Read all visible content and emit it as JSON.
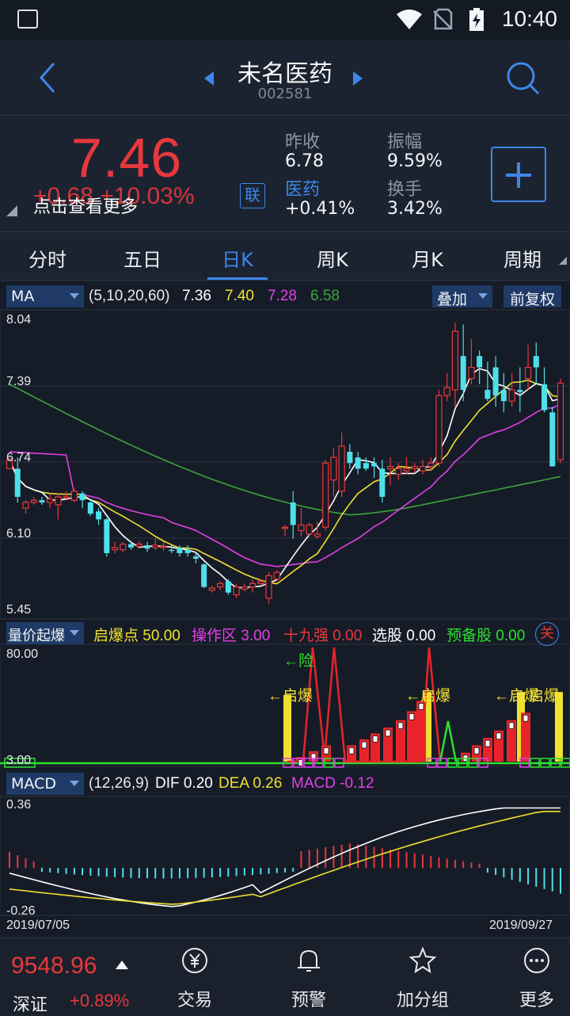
{
  "status": {
    "time": "10:40"
  },
  "header": {
    "name": "未名医药",
    "code": "002581"
  },
  "quote": {
    "price": "7.46",
    "change": "+0.68 +10.03%",
    "tip": "点击查看更多",
    "lian": "联",
    "fields": [
      {
        "key": "昨收",
        "value": "6.78"
      },
      {
        "key": "振幅",
        "value": "9.59%"
      },
      {
        "key": "医药",
        "value": "+0.41%"
      },
      {
        "key": "换手",
        "value": "3.42%"
      }
    ]
  },
  "tabs": [
    "分时",
    "五日",
    "日K",
    "周K",
    "月K",
    "周期"
  ],
  "active_tab": "日K",
  "ma": {
    "label": "MA",
    "params": "(5,10,20,60)",
    "v5": "7.36",
    "v10": "7.40",
    "v20": "7.28",
    "v60": "6.58",
    "overlay": "叠加",
    "adjust": "前复权",
    "yaxis": [
      "8.04",
      "7.39",
      "6.74",
      "6.10",
      "5.45"
    ]
  },
  "vol_indicator": {
    "label": "量价起爆",
    "k1": "启爆点",
    "v1": "50.00",
    "k2": "操作区",
    "v2": "3.00",
    "k3": "十九强",
    "v3": "0.00",
    "k4": "选股",
    "v4": "0.00",
    "k5": "预备股",
    "v5": "0.00",
    "close": "关",
    "ytop": "80.00",
    "ybot": "3.00",
    "annotations": [
      "←险",
      "←启爆",
      "←启爆",
      "←启爆",
      "启爆"
    ]
  },
  "macd": {
    "label": "MACD",
    "params": "(12,26,9)",
    "dif_k": "DIF",
    "dif": "0.20",
    "dea_k": "DEA",
    "dea": "0.26",
    "macd_k": "MACD",
    "macd": "-0.12",
    "ytop": "0.36",
    "ybot": "-0.26",
    "date_start": "2019/07/05",
    "date_end": "2019/09/27"
  },
  "footer": {
    "index_value": "9548.96",
    "index_name": "深证",
    "index_change": "+0.89%",
    "nav": [
      "交易",
      "预警",
      "加分组",
      "更多"
    ]
  },
  "colors": {
    "up": "#e8383d",
    "down": "#4ee0ea",
    "accent": "#3d87ea",
    "ma5": "#ffffff",
    "ma10": "#f0e030",
    "ma20": "#e040e8",
    "ma60": "#3aa63a"
  },
  "chart_data": {
    "type": "candlestick",
    "ylim": [
      5.45,
      8.04
    ],
    "candles": [
      [
        6.7,
        6.78,
        6.75,
        6.8
      ],
      [
        6.7,
        6.45,
        6.8,
        6.4
      ],
      [
        6.35,
        6.4,
        6.42,
        6.3
      ],
      [
        6.4,
        6.42,
        6.45,
        6.38
      ],
      [
        6.42,
        6.4,
        6.45,
        6.38
      ],
      [
        6.4,
        6.43,
        6.48,
        6.35
      ],
      [
        6.38,
        6.45,
        6.48,
        6.25
      ],
      [
        6.45,
        6.45,
        6.5,
        6.42
      ],
      [
        6.42,
        6.5,
        6.52,
        6.4
      ],
      [
        6.48,
        6.42,
        6.5,
        6.35
      ],
      [
        6.4,
        6.3,
        6.42,
        6.28
      ],
      [
        6.32,
        6.25,
        6.35,
        6.2
      ],
      [
        6.25,
        5.95,
        6.26,
        5.92
      ],
      [
        5.98,
        6.0,
        6.05,
        5.95
      ],
      [
        5.98,
        6.03,
        6.05,
        5.96
      ],
      [
        6.03,
        6.0,
        6.06,
        5.98
      ],
      [
        6.01,
        6.03,
        6.06,
        5.99
      ],
      [
        6.02,
        5.99,
        6.05,
        5.96
      ],
      [
        6.0,
        6.02,
        6.08,
        5.98
      ],
      [
        6.0,
        6.01,
        6.05,
        5.97
      ],
      [
        5.98,
        5.97,
        6.02,
        5.95
      ],
      [
        6.0,
        5.95,
        6.02,
        5.92
      ],
      [
        5.98,
        5.95,
        6.02,
        5.92
      ],
      [
        5.92,
        5.9,
        5.96,
        5.86
      ],
      [
        5.85,
        5.65,
        5.86,
        5.64
      ],
      [
        5.62,
        5.64,
        5.66,
        5.6
      ],
      [
        5.65,
        5.68,
        5.7,
        5.62
      ],
      [
        5.7,
        5.6,
        5.72,
        5.58
      ],
      [
        5.58,
        5.65,
        5.68,
        5.55
      ],
      [
        5.63,
        5.65,
        5.68,
        5.61
      ],
      [
        5.65,
        5.68,
        5.72,
        5.6
      ],
      [
        5.68,
        5.7,
        5.72,
        5.66
      ],
      [
        5.55,
        5.75,
        5.78,
        5.5
      ],
      [
        5.72,
        5.78,
        5.8,
        5.7
      ],
      [
        6.18,
        6.18,
        6.2,
        6.1
      ],
      [
        6.4,
        6.2,
        6.5,
        6.08
      ],
      [
        6.15,
        6.2,
        6.35,
        6.1
      ],
      [
        6.12,
        6.2,
        6.22,
        6.1
      ],
      [
        6.1,
        6.12,
        6.23,
        6.08
      ],
      [
        6.18,
        6.75,
        6.78,
        6.15
      ],
      [
        6.6,
        6.8,
        6.88,
        6.45
      ],
      [
        6.5,
        6.9,
        7.02,
        6.45
      ],
      [
        6.85,
        6.75,
        6.92,
        6.7
      ],
      [
        6.8,
        6.7,
        6.85,
        6.65
      ],
      [
        6.75,
        6.7,
        6.8,
        6.68
      ],
      [
        6.75,
        6.72,
        6.8,
        6.62
      ],
      [
        6.7,
        6.45,
        6.78,
        6.4
      ],
      [
        6.7,
        6.72,
        6.8,
        6.55
      ],
      [
        6.65,
        6.7,
        6.75,
        6.6
      ],
      [
        6.68,
        6.7,
        6.8,
        6.65
      ],
      [
        6.7,
        6.72,
        6.75,
        6.66
      ],
      [
        6.68,
        6.72,
        6.78,
        6.65
      ],
      [
        6.72,
        6.75,
        6.8,
        6.68
      ],
      [
        6.75,
        7.35,
        7.4,
        6.72
      ],
      [
        7.35,
        7.42,
        7.55,
        7.3
      ],
      [
        7.4,
        7.92,
        8.0,
        7.25
      ],
      [
        7.7,
        7.4,
        7.98,
        7.3
      ],
      [
        7.5,
        7.6,
        7.85,
        7.45
      ],
      [
        7.7,
        7.6,
        7.75,
        7.45
      ],
      [
        7.4,
        7.32,
        7.65,
        7.3
      ],
      [
        7.6,
        7.35,
        7.7,
        7.25
      ],
      [
        7.4,
        7.3,
        7.55,
        7.2
      ],
      [
        7.3,
        7.4,
        7.55,
        7.25
      ],
      [
        7.4,
        7.38,
        7.6,
        7.2
      ],
      [
        7.5,
        7.6,
        7.8,
        7.4
      ],
      [
        7.7,
        7.6,
        7.82,
        7.45
      ],
      [
        7.45,
        7.22,
        7.6,
        7.2
      ],
      [
        7.2,
        6.72,
        7.25,
        6.72
      ],
      [
        6.78,
        7.46,
        7.5,
        6.75
      ]
    ]
  }
}
